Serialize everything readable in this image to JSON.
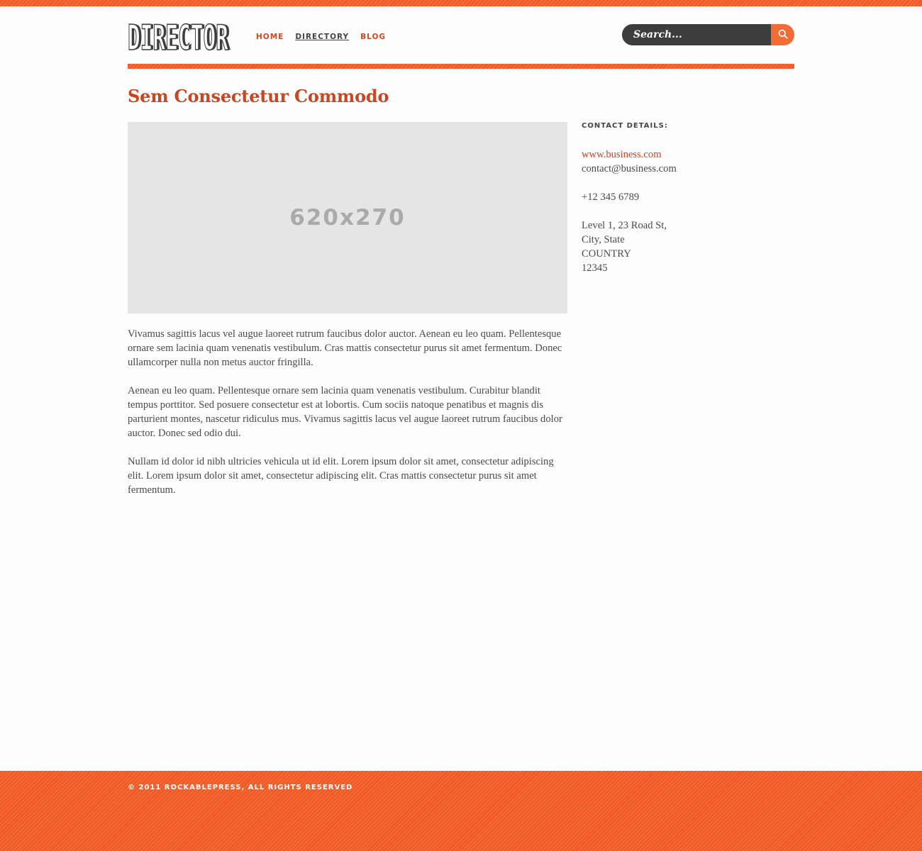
{
  "header": {
    "logo_text": "DIRECTOR",
    "nav": [
      {
        "label": "HOME",
        "active": false
      },
      {
        "label": "DIRECTORY",
        "active": true
      },
      {
        "label": "BLOG",
        "active": false
      }
    ],
    "search": {
      "placeholder": "Search...",
      "icon": "search-icon"
    }
  },
  "colors": {
    "accent": "#f15a24",
    "title": "#c94621",
    "search_bg": "#3d3d3d",
    "search_button": "#f26c35",
    "placeholder_bg": "#e5e5e5"
  },
  "main": {
    "title": "Sem Consectetur Commodo",
    "image_placeholder": "620x270",
    "paragraphs": [
      "Vivamus sagittis lacus vel augue laoreet rutrum faucibus dolor auctor. Aenean eu leo quam. Pellentesque ornare sem lacinia quam venenatis vestibulum. Cras mattis consectetur purus sit amet fermentum. Donec ullamcorper nulla non metus auctor fringilla.",
      "Aenean eu leo quam. Pellentesque ornare sem lacinia quam venenatis vestibulum. Curabitur blandit tempus porttitor. Sed posuere consectetur est at lobortis. Cum sociis natoque penatibus et magnis dis parturient montes, nascetur ridiculus mus. Vivamus sagittis lacus vel augue laoreet rutrum faucibus dolor auctor. Donec sed odio dui.",
      "Nullam id dolor id nibh ultricies vehicula ut id elit. Lorem ipsum dolor sit amet, consectetur adipiscing elit. Lorem ipsum dolor sit amet, consectetur adipiscing elit. Cras mattis consectetur purus sit amet fermentum."
    ]
  },
  "sidebar": {
    "heading": "CONTACT DETAILS:",
    "website": "www.business.com",
    "email": "contact@business.com",
    "phone": "+12 345 6789",
    "address": [
      "Level 1, 23 Road St,",
      "City, State",
      "COUNTRY",
      "12345"
    ]
  },
  "footer": {
    "copyright": "© 2011 ROCKABLEPRESS, ALL RIGHTS RESERVED"
  }
}
